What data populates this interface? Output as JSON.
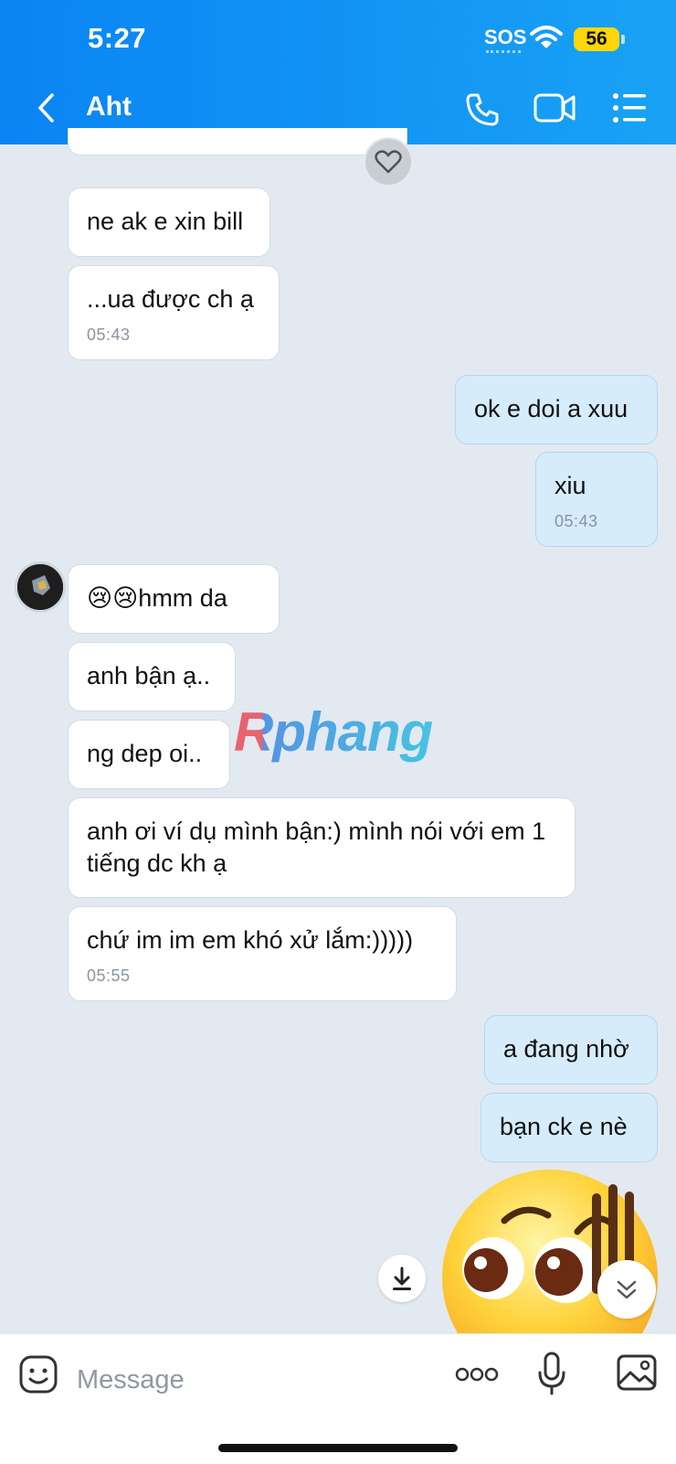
{
  "status_bar": {
    "time": "5:27",
    "sos": "SOS",
    "battery": "56"
  },
  "header": {
    "title": "Aht",
    "icons": [
      "back-chevron-icon",
      "phone-icon",
      "video-camera-icon",
      "menu-list-icon"
    ]
  },
  "messages": [
    {
      "side": "in",
      "text": "ne ak e xin bill",
      "time": ""
    },
    {
      "side": "in",
      "text": "...ua được ch ạ",
      "time": "05:43"
    },
    {
      "side": "out",
      "text": "ok e doi a xuu",
      "time": ""
    },
    {
      "side": "out",
      "text": "xiu",
      "time": "05:43"
    },
    {
      "side": "in",
      "text": "hmm da",
      "emoji": "😢😢",
      "time": ""
    },
    {
      "side": "in",
      "text": "anh bận ạ..",
      "time": ""
    },
    {
      "side": "in",
      "text": "ng dep oi..",
      "time": ""
    },
    {
      "side": "in",
      "text": "anh ơi ví dụ mình bận:) mình nói với em 1 tiếng dc kh ạ",
      "time": ""
    },
    {
      "side": "in",
      "text": "chứ im im em khó xử lắm:)))))",
      "time": "05:55"
    },
    {
      "side": "out",
      "text": "a đang nhờ",
      "time": ""
    },
    {
      "side": "out",
      "text": "bạn ck e nè",
      "time": ""
    }
  ],
  "watermark": "Rphang",
  "composer": {
    "placeholder": "Message"
  },
  "colors": {
    "header": "#0a84f3",
    "background": "#e3e9f0",
    "outgoing_bubble": "#d6ecfb",
    "incoming_bubble": "#ffffff"
  }
}
